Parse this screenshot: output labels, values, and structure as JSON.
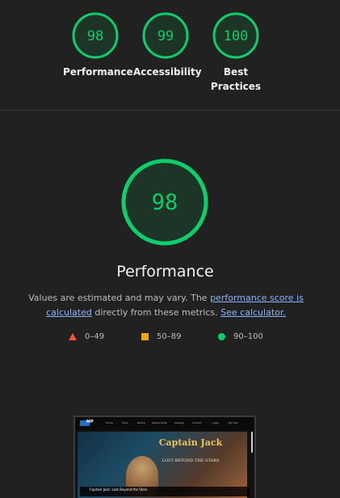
{
  "colors": {
    "pass": "#0cce6b",
    "average": "#ffa400",
    "fail": "#ff4e42",
    "pass_bg": "#1d3527",
    "link": "#8ab4f8"
  },
  "top_scores": [
    {
      "score": "98",
      "label": "Performance"
    },
    {
      "score": "99",
      "label": "Accessibility"
    },
    {
      "score": "100",
      "label_lines": [
        "Best",
        "Practices"
      ]
    }
  ],
  "main": {
    "score": "98",
    "title": "Performance",
    "desc_text_1": "Values are estimated and may vary. The ",
    "desc_link_1": "performance score is calculated",
    "desc_text_2": " directly from these metrics. ",
    "desc_link_2": "See calculator."
  },
  "legend": [
    {
      "icon": "triangle-icon",
      "range": "0–49"
    },
    {
      "icon": "square-icon",
      "range": "50–89"
    },
    {
      "icon": "circle-icon",
      "range": "90–100"
    }
  ],
  "screenshot": {
    "logo_text": "MP",
    "nav_items": [
      "Home",
      "Shop",
      "Rating",
      "People Write",
      "Catalog",
      "Contact",
      "Login",
      "My Cart"
    ],
    "hero_title": "Captain Jack",
    "hero_subtitle": "LOST BEYOND THE STARS",
    "caption": "Captain Jack: Lost Beyond the Stars"
  }
}
